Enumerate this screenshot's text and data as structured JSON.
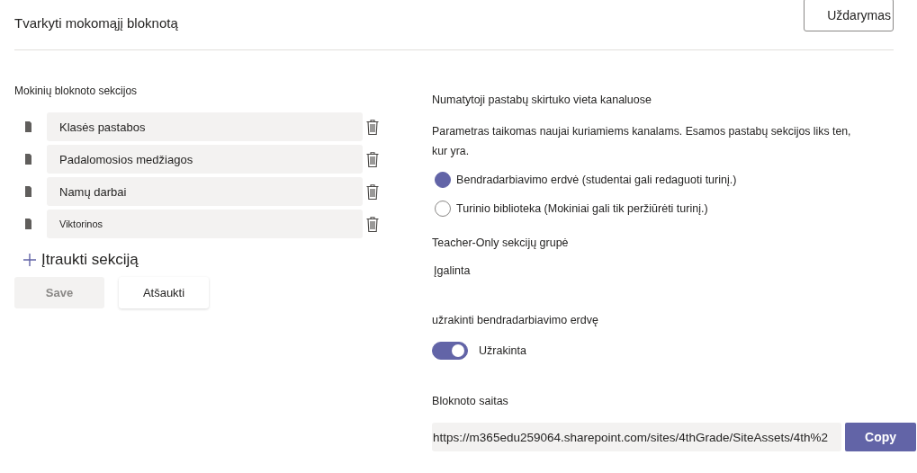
{
  "header": {
    "title": "Tvarkyti mokomąjį bloknotą",
    "close_button": "Uždarymas"
  },
  "sections": {
    "label": "Mokinių bloknoto sekcijos",
    "items": [
      {
        "name": "Klasės pastabos"
      },
      {
        "name": "Padalomosios medžiagos"
      },
      {
        "name": "Namų darbai"
      },
      {
        "name": "Viktorinos"
      }
    ],
    "add_button": "Įtraukti sekciją",
    "save_button": {
      "label": "Save",
      "disabled": true
    },
    "cancel_button": "Atšaukti"
  },
  "tab_location": {
    "label": "Numatytoji pastabų skirtuko vieta kanaluose",
    "description": "Parametras taikomas naujai kuriamiems kanalams. Esamos pastabų sekcijos liks ten, kur yra.",
    "options": [
      {
        "label": "Bendradarbiavimo erdvė (studentai gali redaguoti turinį.)",
        "selected": true
      },
      {
        "label": "Turinio biblioteka (Mokiniai gali tik peržiūrėti turinį.)",
        "selected": false
      }
    ]
  },
  "teacher_only": {
    "label": "Teacher-Only sekcijų grupė",
    "value": "Įgalinta"
  },
  "lock": {
    "label": "užrakinti bendradarbiavimo erdvę",
    "toggle": {
      "label": "Užrakinta",
      "on": true
    }
  },
  "link": {
    "label": "Bloknoto saitas",
    "url": "https://m365edu259064.sharepoint.com/sites/4thGrade/SiteAssets/4th%2",
    "copy_button": "Copy"
  }
}
